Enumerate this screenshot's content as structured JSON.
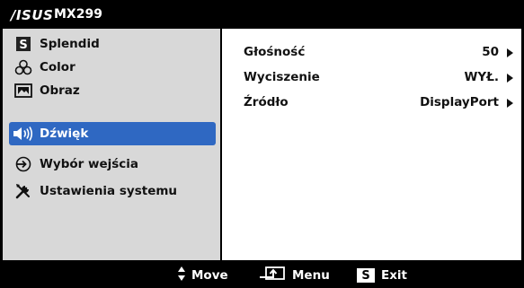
{
  "header": {
    "logo": "/ISUS",
    "model": "MX299"
  },
  "sidebar": {
    "items": [
      {
        "label": "Splendid",
        "icon": "splendid-s-icon",
        "active": false
      },
      {
        "label": "Color",
        "icon": "color-circles-icon",
        "active": false
      },
      {
        "label": "Obraz",
        "icon": "image-icon",
        "active": false
      },
      {
        "label": "Dźwięk",
        "icon": "speaker-icon",
        "active": true
      },
      {
        "label": "Wybór wejścia",
        "icon": "input-source-icon",
        "active": false
      },
      {
        "label": "Ustawienia systemu",
        "icon": "tools-icon",
        "active": false
      }
    ]
  },
  "main": {
    "rows": [
      {
        "label": "Głośność",
        "value": "50"
      },
      {
        "label": "Wyciszenie",
        "value": "WYŁ."
      },
      {
        "label": "Źródło",
        "value": "DisplayPort"
      }
    ]
  },
  "footer": {
    "move_label": "Move",
    "menu_label": "Menu",
    "exit_key": "S",
    "exit_label": "Exit"
  },
  "colors": {
    "background": "#000000",
    "sidebar": "#d8d8d8",
    "active": "#2f68c2",
    "panel": "#ffffff"
  }
}
